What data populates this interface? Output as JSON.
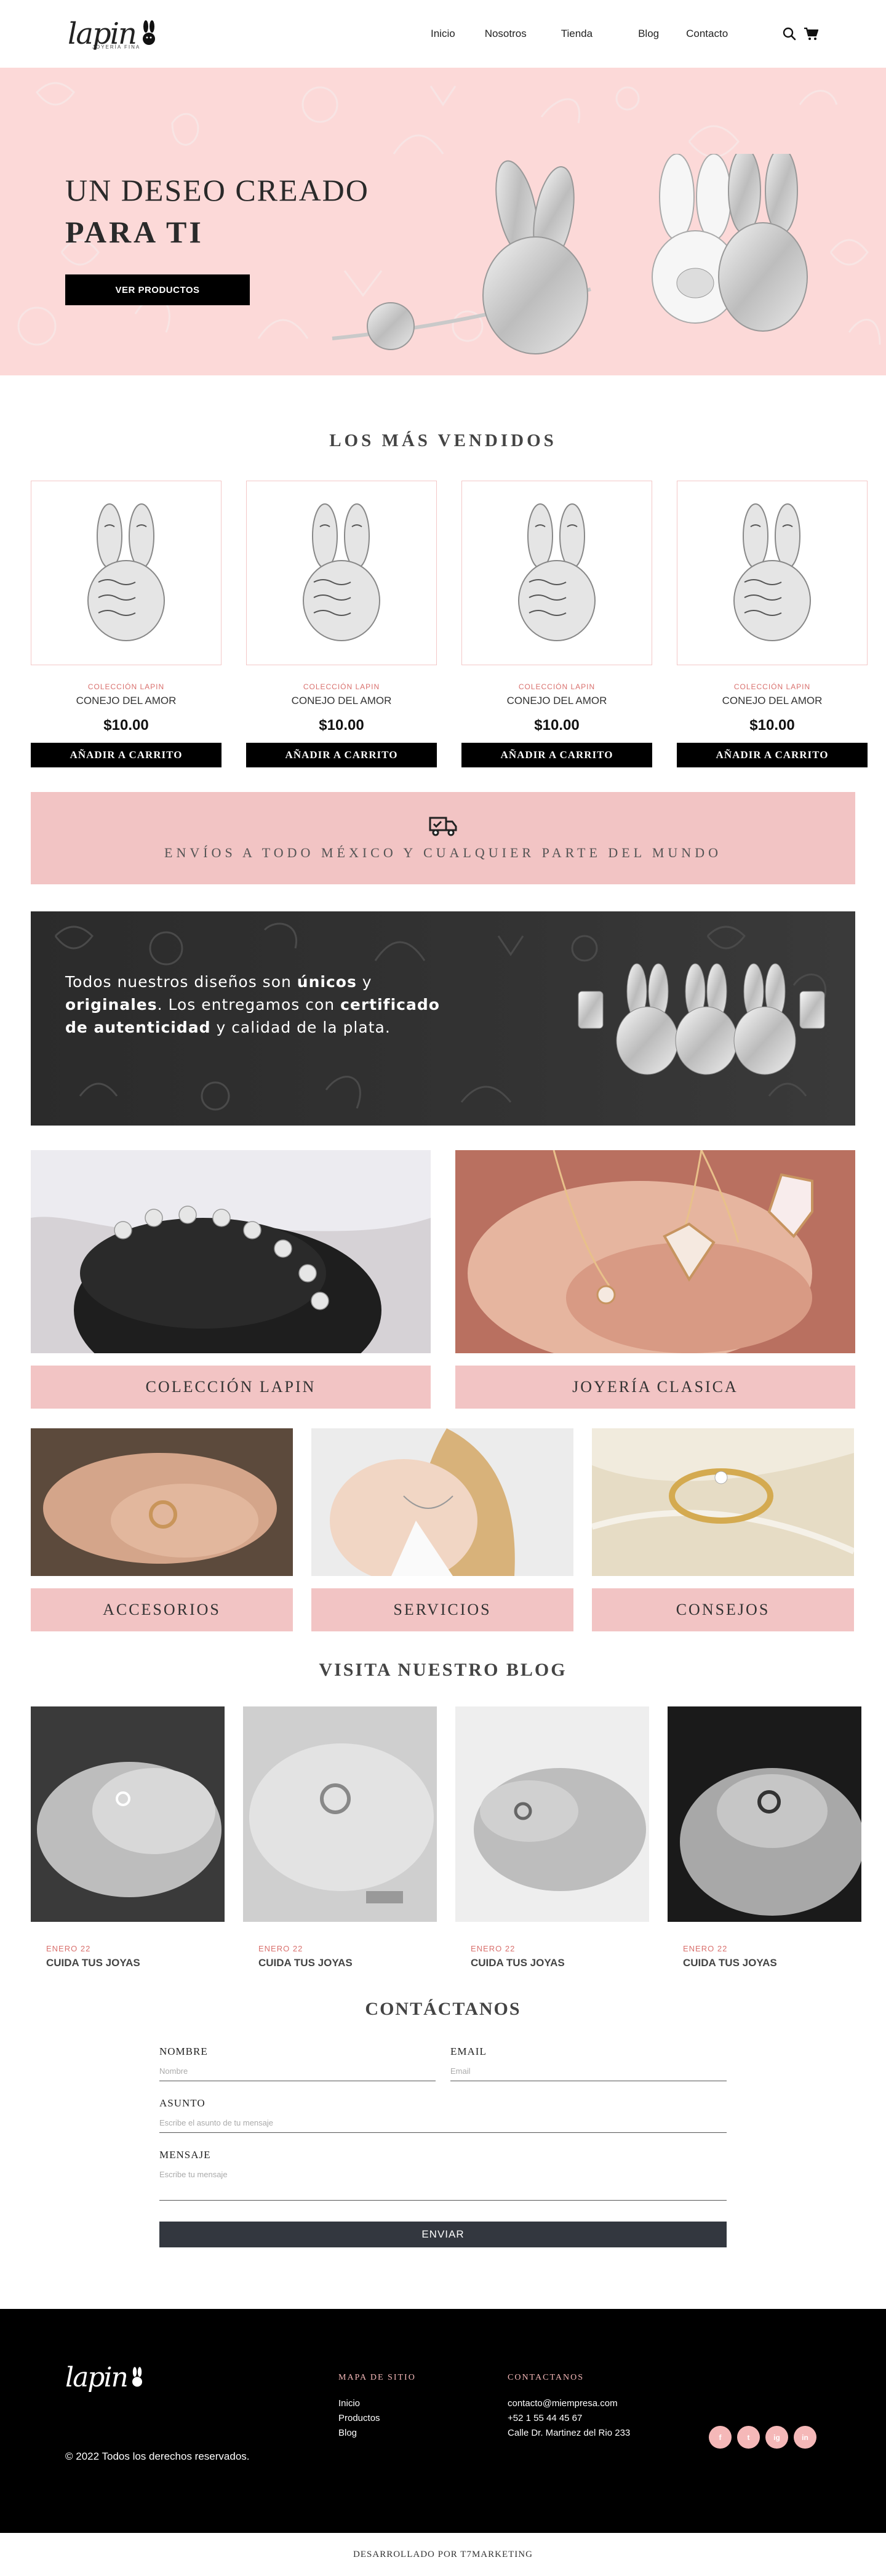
{
  "header": {
    "logo_text": "lapin",
    "logo_tagline": "JOYERÍA FINA",
    "nav": [
      "Inicio",
      "Nosotros",
      "Tienda",
      "Blog",
      "Contacto"
    ]
  },
  "hero": {
    "title_line1": "UN DESEO CREADO",
    "title_line2": "PARA TI",
    "button": "VER PRODUCTOS"
  },
  "bestsellers": {
    "title": "LOS MÁS VENDIDOS",
    "products": [
      {
        "category": "COLECCIÓN LAPIN",
        "name": "CONEJO DEL AMOR",
        "price": "$10.00",
        "button": "AÑADIR A CARRITO"
      },
      {
        "category": "COLECCIÓN LAPIN",
        "name": "CONEJO DEL AMOR",
        "price": "$10.00",
        "button": "AÑADIR A CARRITO"
      },
      {
        "category": "COLECCIÓN LAPIN",
        "name": "CONEJO DEL AMOR",
        "price": "$10.00",
        "button": "AÑADIR A CARRITO"
      },
      {
        "category": "COLECCIÓN LAPIN",
        "name": "CONEJO DEL AMOR",
        "price": "$10.00",
        "button": "AÑADIR A CARRITO"
      }
    ]
  },
  "shipping": {
    "text": "ENVÍOS A TODO MÉXICO Y CUALQUIER PARTE DEL MUNDO"
  },
  "promo": {
    "t1": "Todos nuestros diseños son ",
    "b1": "únicos",
    "t2": " y ",
    "b2": "originales",
    "t3": ". Los entregamos con ",
    "b3": "certificado de autenticidad",
    "t4": " y calidad de la plata."
  },
  "categories": {
    "large": [
      "COLECCIÓN LAPIN",
      "JOYERÍA CLASICA"
    ],
    "small": [
      "ACCESORIOS",
      "SERVICIOS",
      "CONSEJOS"
    ]
  },
  "blog": {
    "title": "VISITA NUESTRO BLOG",
    "posts": [
      {
        "date": "ENERO 22",
        "title": "CUIDA TUS JOYAS"
      },
      {
        "date": "ENERO 22",
        "title": "CUIDA TUS JOYAS"
      },
      {
        "date": "ENERO 22",
        "title": "CUIDA TUS JOYAS"
      },
      {
        "date": "ENERO 22",
        "title": "CUIDA TUS JOYAS"
      }
    ]
  },
  "contact": {
    "title": "CONTÁCTANOS",
    "name_label": "NOMBRE",
    "name_placeholder": "Nombre",
    "email_label": "EMAIL",
    "email_placeholder": "Email",
    "subject_label": "ASUNTO",
    "subject_placeholder": "Escribe el asunto de tu mensaje",
    "message_label": "MENSAJE",
    "message_placeholder": "Escribe tu mensaje",
    "submit": "ENVIAR"
  },
  "footer": {
    "logo_text": "lapin",
    "copyright": "© 2022 Todos los derechos reservados.",
    "sitemap_title": "MAPA DE SITIO",
    "sitemap_links": [
      "Inicio",
      "Productos",
      "Blog"
    ],
    "contact_title": "CONTACTANOS",
    "email": "contacto@miempresa.com",
    "phone": "+52 1 55 44 45 67",
    "address": "Calle Dr. Martinez del Rio 233",
    "social": [
      "f",
      "t",
      "ig",
      "in"
    ],
    "developer": "DESARROLLADO POR T7MARKETING"
  }
}
